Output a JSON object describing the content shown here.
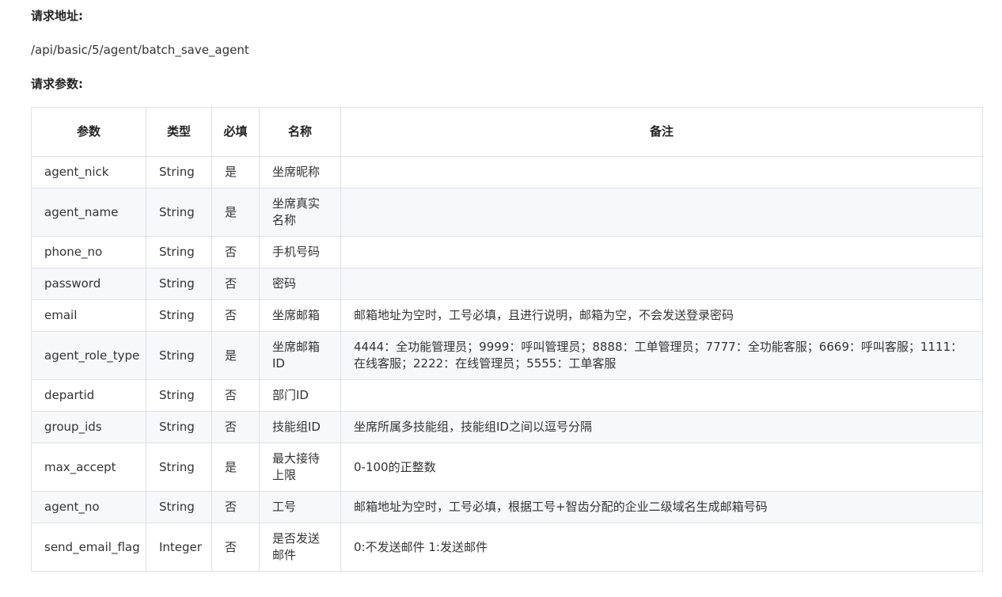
{
  "request_url_label": "请求地址:",
  "request_url": "/api/basic/5/agent/batch_save_agent",
  "request_params_label": "请求参数:",
  "table": {
    "headers": {
      "param": "参数",
      "type": "类型",
      "required": "必填",
      "name": "名称",
      "note": "备注"
    },
    "rows": [
      {
        "param": "agent_nick",
        "type": "String",
        "required": "是",
        "name": "坐席昵称",
        "note": ""
      },
      {
        "param": "agent_name",
        "type": "String",
        "required": "是",
        "name": "坐席真实名称",
        "note": ""
      },
      {
        "param": "phone_no",
        "type": "String",
        "required": "否",
        "name": "手机号码",
        "note": ""
      },
      {
        "param": "password",
        "type": "String",
        "required": "否",
        "name": "密码",
        "note": ""
      },
      {
        "param": "email",
        "type": "String",
        "required": "否",
        "name": "坐席邮箱",
        "note": "邮箱地址为空时，工号必填，且进行说明，邮箱为空，不会发送登录密码"
      },
      {
        "param": "agent_role_type",
        "type": "String",
        "required": "是",
        "name": "坐席邮箱ID",
        "note": "4444：全功能管理员；9999：呼叫管理员；8888：工单管理员；7777：全功能客服；6669：呼叫客服；1111：在线客服；2222：在线管理员；5555：工单客服"
      },
      {
        "param": "departid",
        "type": "String",
        "required": "否",
        "name": "部门ID",
        "note": ""
      },
      {
        "param": "group_ids",
        "type": "String",
        "required": "否",
        "name": "技能组ID",
        "note": "坐席所属多技能组，技能组ID之间以逗号分隔"
      },
      {
        "param": "max_accept",
        "type": "String",
        "required": "是",
        "name": "最大接待上限",
        "note": "0-100的正整数"
      },
      {
        "param": "agent_no",
        "type": "String",
        "required": "否",
        "name": "工号",
        "note": "邮箱地址为空时，工号必填，根据工号+智齿分配的企业二级域名生成邮箱号码"
      },
      {
        "param": "send_email_flag",
        "type": "Integer",
        "required": "否",
        "name": "是否发送邮件",
        "note": "0:不发送邮件 1:发送邮件"
      }
    ]
  }
}
